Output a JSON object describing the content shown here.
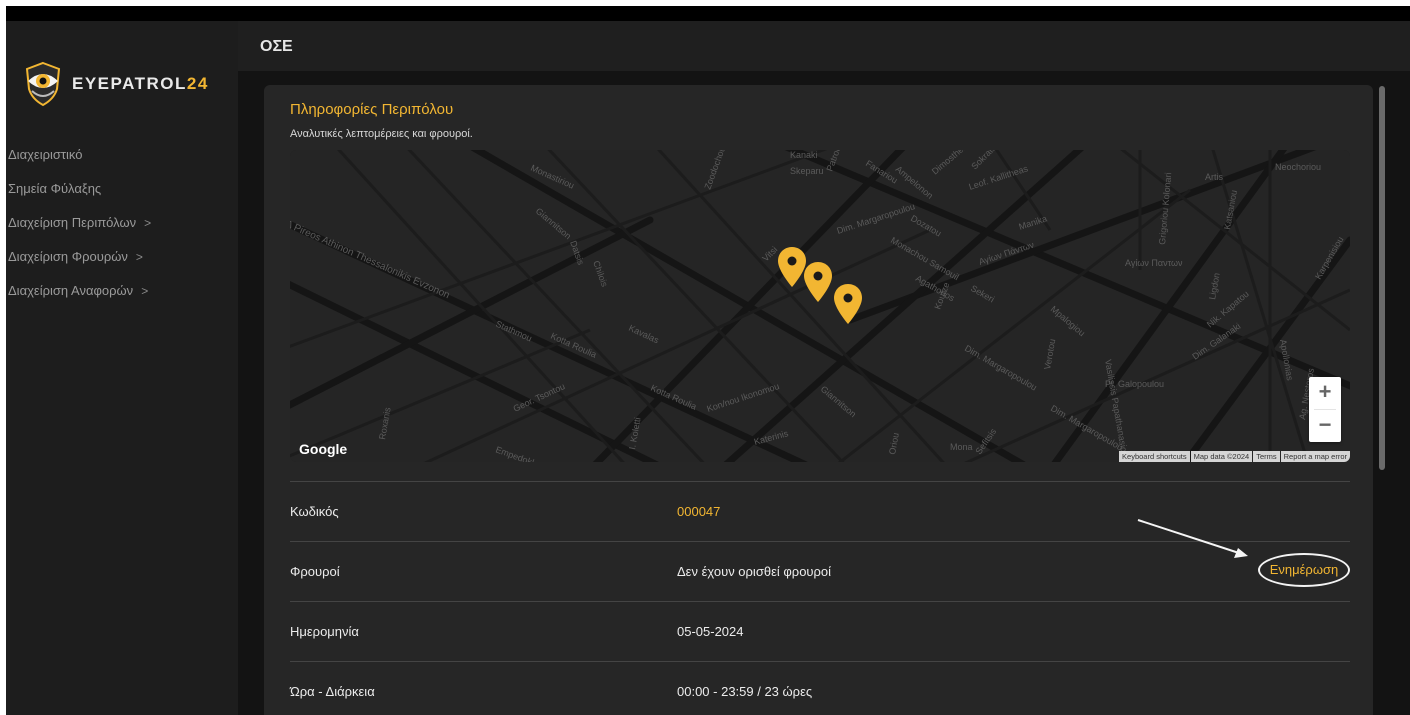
{
  "app": {
    "logo_text_main": "EYEPATROL",
    "logo_text_accent": "24",
    "brand_color": "#f2b632"
  },
  "sidebar": {
    "items": [
      {
        "label": "Διαχειριστικό",
        "has_chevron": false
      },
      {
        "label": "Σημεία Φύλαξης",
        "has_chevron": false
      },
      {
        "label": "Διαχείριση Περιπόλων",
        "has_chevron": true,
        "chevron": ">"
      },
      {
        "label": "Διαχείριση Φρουρών",
        "has_chevron": true,
        "chevron": ">"
      },
      {
        "label": "Διαχείριση Αναφορών",
        "has_chevron": true,
        "chevron": ">"
      }
    ]
  },
  "header": {
    "title": "ΟΣΕ"
  },
  "card": {
    "title": "Πληροφορίες Περιπόλου",
    "subtitle": "Αναλυτικές λεπτομέρειες και φρουροί."
  },
  "map": {
    "google_label": "Google",
    "zoom_in": "+",
    "zoom_out": "−",
    "attribution": [
      "Keyboard shortcuts",
      "Map data ©2024",
      "Terms",
      "Report a map error"
    ],
    "marker_color": "#f2b632",
    "street_labels": [
      "Monastiriou",
      "Giannitson",
      "Datsis",
      "Chilois",
      "Kavalas",
      "Kotta Roulia",
      "Stathmou",
      "Zoodochou",
      "Kanaki",
      "Skeparu",
      "Patroc",
      "Fanariou",
      "Ampelonon",
      "Dimosthen",
      "Sokrato",
      "Leof. Kallitheas",
      "Dim. Margaropoulou",
      "Monachou Samouil",
      "Dozatou",
      "Αγίων Πάντων",
      "Manika",
      "Agathonos",
      "Koutze",
      "Sekeri",
      "Vitsi",
      "Dim. Margaropoulou",
      "Giannitson",
      "Kon/nou Ikonomou",
      "Kotta Roulia",
      "Geor. Tsontou",
      "Katerinis",
      "Roxanis",
      "Empedokl",
      "I. Koletti",
      "Pl. Galopoulou",
      "Dim. Galanaki",
      "Nik. Kapatou",
      "Artis",
      "Neochoriou",
      "Grigoriou Kolonari",
      "Vasilissis Papathanasiou",
      "Mpalogiou",
      "Ligdon",
      "Katsaniou",
      "Verotou",
      "Mona",
      "Sefitsis",
      "Oriou",
      "Apollonias",
      "Ag. Nestoros",
      "Karpenisiou",
      "Δ Pireos Athinon Thessalonikis Evzonon",
      "Αγίων Παντων",
      "Dim. Margaropoulou"
    ]
  },
  "details": [
    {
      "label": "Κωδικός",
      "value": "000047",
      "accent": true
    },
    {
      "label": "Φρουροί",
      "value": "Δεν έχουν ορισθεί φρουροί",
      "accent": false
    },
    {
      "label": "Ημερομηνία",
      "value": "05-05-2024",
      "accent": false
    },
    {
      "label": "Ώρα - Διάρκεια",
      "value": "00:00 - 23:59 / 23 ώρες",
      "accent": false
    }
  ],
  "actions": {
    "update_label": "Ενημέρωση"
  }
}
